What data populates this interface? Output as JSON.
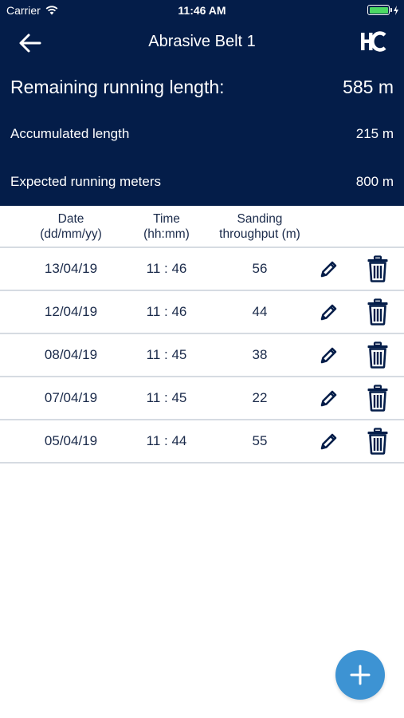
{
  "status_bar": {
    "carrier": "Carrier",
    "time": "11:46 AM"
  },
  "header": {
    "title": "Abrasive Belt 1",
    "remaining_label": "Remaining running length:",
    "remaining_value": "585 m",
    "accumulated_label": "Accumulated length",
    "accumulated_value": "215 m",
    "expected_label": "Expected running meters",
    "expected_value": "800 m"
  },
  "table": {
    "columns": [
      "Date\n(dd/mm/yy)",
      "Time\n(hh:mm)",
      "Sanding\nthroughput (m)"
    ],
    "rows": [
      {
        "date": "13/04/19",
        "time": "11 : 46",
        "throughput": "56"
      },
      {
        "date": "12/04/19",
        "time": "11 : 46",
        "throughput": "44"
      },
      {
        "date": "08/04/19",
        "time": "11 : 45",
        "throughput": "38"
      },
      {
        "date": "07/04/19",
        "time": "11 : 45",
        "throughput": "22"
      },
      {
        "date": "05/04/19",
        "time": "11 : 44",
        "throughput": "55"
      }
    ]
  },
  "colors": {
    "header_bg": "#041d49",
    "accent": "#3d93d3",
    "battery": "#4cd964"
  },
  "icons": {
    "back": "arrow-left-icon",
    "logo": "hc-logo-icon",
    "edit": "pencil-icon",
    "delete": "trash-icon",
    "add": "plus-icon"
  }
}
